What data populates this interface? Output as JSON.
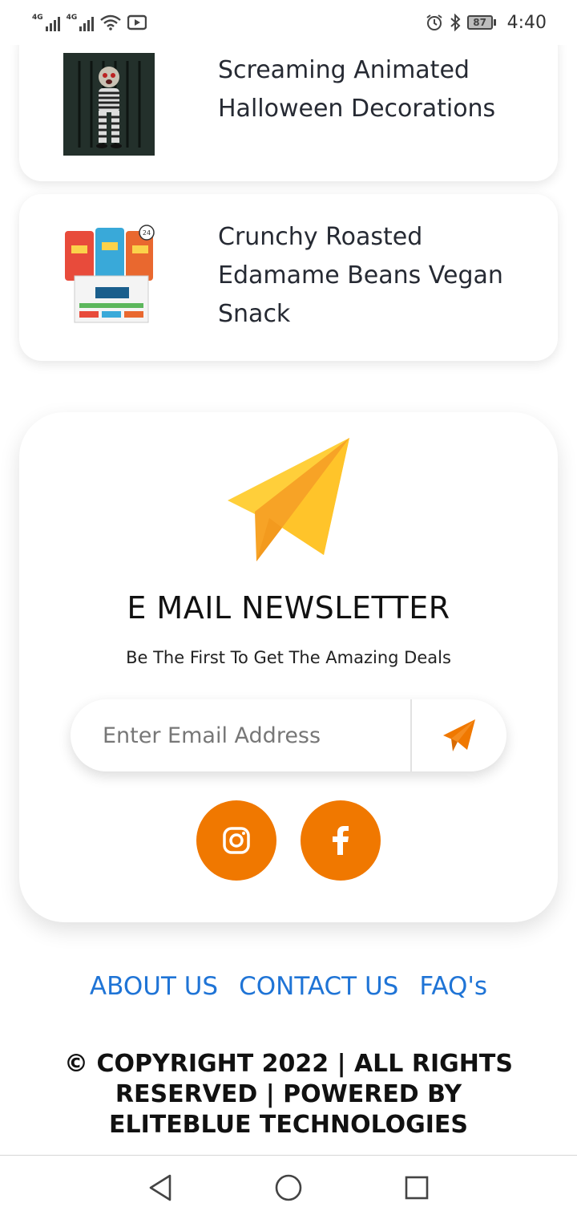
{
  "status_bar": {
    "signal1_label": "4G",
    "signal2_label": "4G",
    "battery": "87",
    "time": "4:40",
    "icons": [
      "signal-icon",
      "wifi-icon",
      "screen-record-icon",
      "alarm-icon",
      "bluetooth-icon",
      "battery-icon"
    ]
  },
  "products": [
    {
      "title": "Screaming Animated Halloween Decorations",
      "icon": "halloween-figure-image"
    },
    {
      "title": "Crunchy Roasted Edamame Beans Vegan Snack",
      "icon": "edamame-snack-image"
    }
  ],
  "newsletter": {
    "title": "E MAIL NEWSLETTER",
    "subtitle": "Be The First To Get The Amazing Deals",
    "email_placeholder": "Enter Email Address",
    "email_value": "",
    "send_icon": "send-icon"
  },
  "social": [
    {
      "name": "Instagram",
      "icon": "instagram-icon"
    },
    {
      "name": "Facebook",
      "icon": "facebook-icon"
    }
  ],
  "footer": {
    "links": [
      "ABOUT US",
      "CONTACT US",
      "FAQ's"
    ],
    "copyright": "© COPYRIGHT 2022 | ALL RIGHTS RESERVED | POWERED BY ELITEBLUE TECHNOLOGIES"
  },
  "colors": {
    "accent": "#f07800",
    "link": "#1f74d6",
    "plane_light": "#ffcf3a",
    "plane_dark": "#f7a326"
  }
}
